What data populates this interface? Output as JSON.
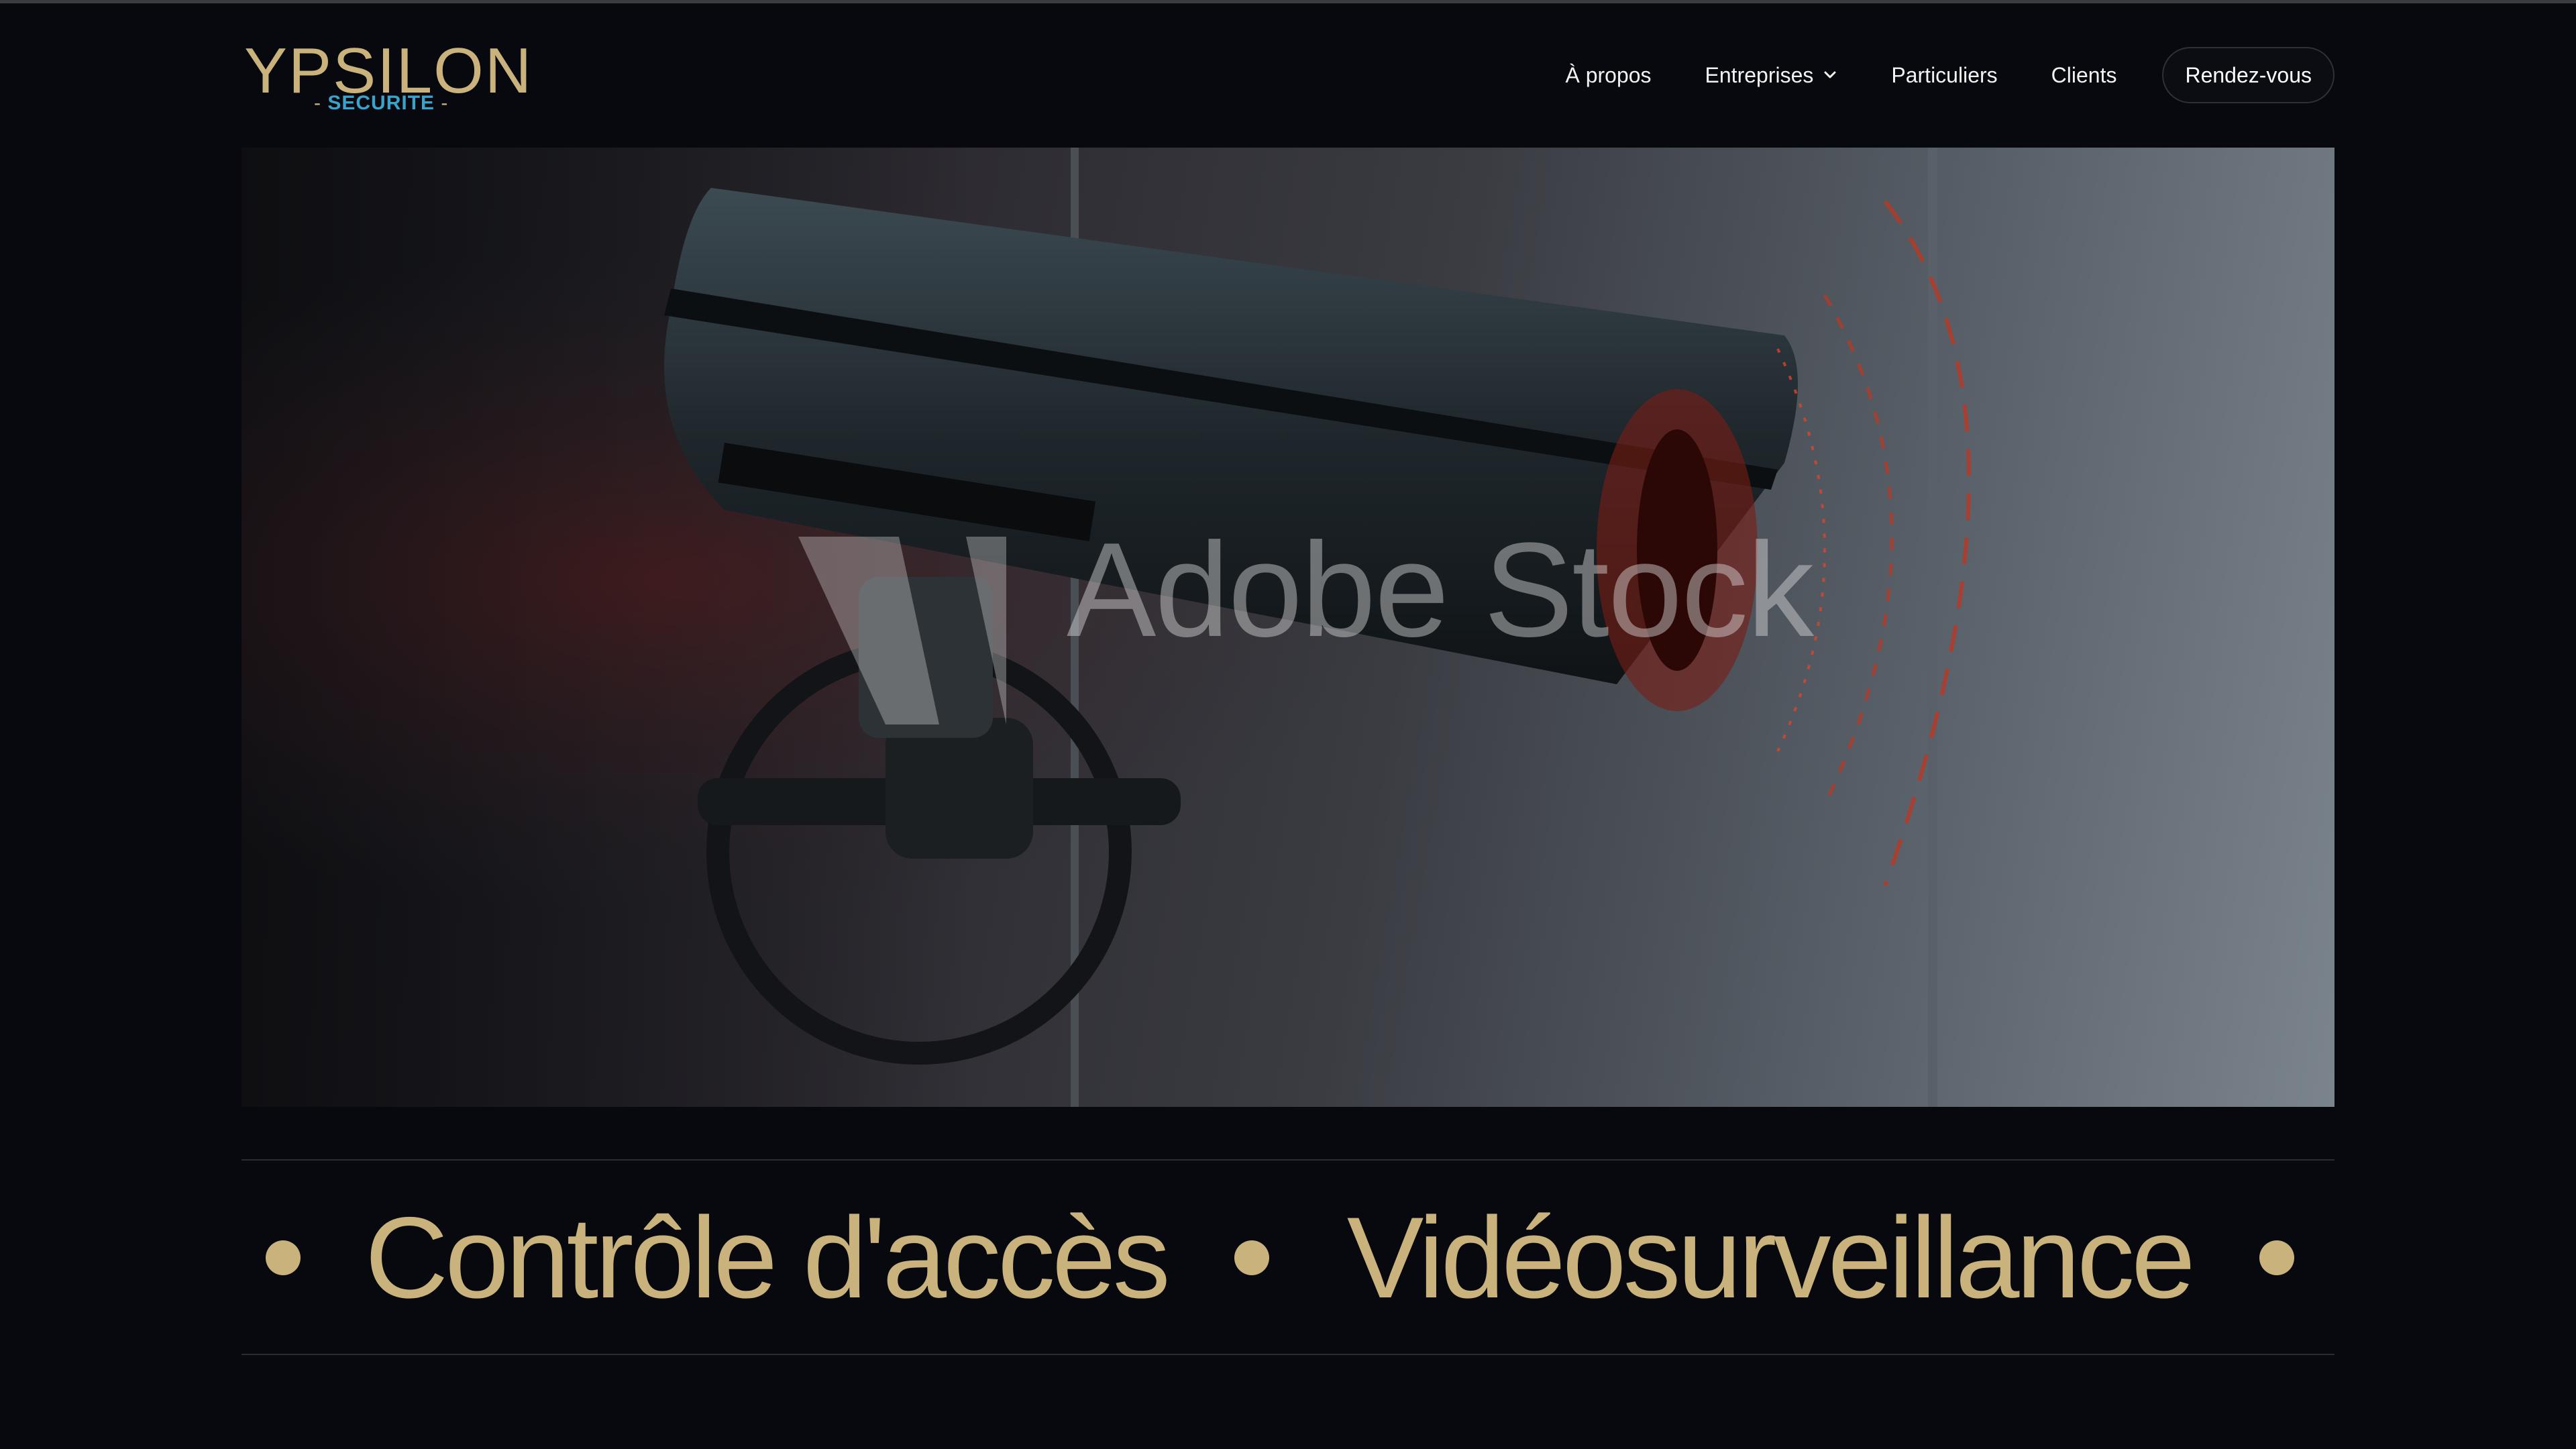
{
  "header": {
    "logo": {
      "wordmark": "YPSILON",
      "tagline": "SECURITE",
      "tagline_dash": "-",
      "gold": "#c9b27b",
      "blue": "#3aa3cc"
    },
    "nav": {
      "items": [
        {
          "label": "À propos"
        },
        {
          "label": "Entreprises",
          "has_dropdown": true,
          "icon": "chevron-down-icon"
        },
        {
          "label": "Particuliers"
        },
        {
          "label": "Clients"
        }
      ],
      "cta_label": "Rendez-vous"
    }
  },
  "hero": {
    "media": "security-camera-image",
    "watermark": "Adobe Stock"
  },
  "services_marquee": {
    "items": [
      "Contrôle d'accès",
      "Vidéosurveillance"
    ],
    "bullet_icon": "dot-icon"
  },
  "colors": {
    "background": "#07090f",
    "accent": "#c9b27b",
    "divider": "#2a2c33"
  }
}
